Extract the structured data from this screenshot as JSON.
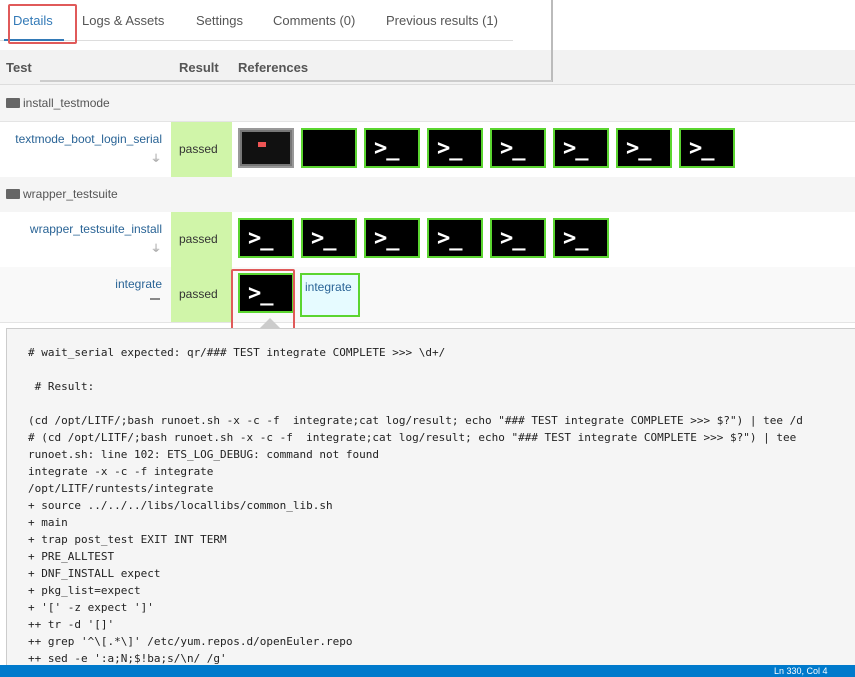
{
  "tabs": [
    {
      "label": "Details"
    },
    {
      "label": "Logs & Assets"
    },
    {
      "label": "Settings"
    },
    {
      "label": "Comments (0)"
    },
    {
      "label": "Previous results (1)"
    }
  ],
  "table": {
    "headers": {
      "test": "Test",
      "result": "Result",
      "references": "References"
    },
    "groups": [
      {
        "name": "install_testmode"
      },
      {
        "name": "wrapper_testsuite"
      }
    ],
    "rows": [
      {
        "name": "textmode_boot_login_serial",
        "result": "passed"
      },
      {
        "name": "wrapper_testsuite_install",
        "result": "passed"
      },
      {
        "name": "integrate",
        "result": "passed",
        "ref_label": "integrate"
      }
    ]
  },
  "icons": {
    "folder": "folder-open-icon",
    "plug": "plug-icon",
    "terminal": "terminal-icon",
    "minus": "minus-icon"
  },
  "colors": {
    "passed_bg": "#d0f5a9",
    "thumb_border": "#5bd530",
    "highlight": "#e05a5a",
    "link": "#2a6496"
  },
  "terminal_glyph": ">_",
  "log": {
    "lines": [
      "# wait_serial expected: qr/### TEST integrate COMPLETE >>> \\d+/",
      "",
      " # Result:",
      "",
      "(cd /opt/LITF/;bash runoet.sh -x -c -f  integrate;cat log/result; echo \"### TEST integrate COMPLETE >>> $?\") | tee /d",
      "# (cd /opt/LITF/;bash runoet.sh -x -c -f  integrate;cat log/result; echo \"### TEST integrate COMPLETE >>> $?\") | tee",
      "runoet.sh: line 102: ETS_LOG_DEBUG: command not found",
      "integrate -x -c -f integrate",
      "/opt/LITF/runtests/integrate",
      "+ source ../../../libs/locallibs/common_lib.sh",
      "+ main",
      "+ trap post_test EXIT INT TERM",
      "+ PRE_ALLTEST",
      "+ DNF_INSTALL expect",
      "+ pkg_list=expect",
      "+ '[' -z expect ']'",
      "++ tr -d '[]'",
      "++ grep '^\\[.*\\]' /etc/yum.repos.d/openEuler.repo",
      "++ sed -e ':a;N;$!ba;s/\\n/ /g'"
    ]
  },
  "statusbar": {
    "position": "Ln 330, Col 4"
  }
}
